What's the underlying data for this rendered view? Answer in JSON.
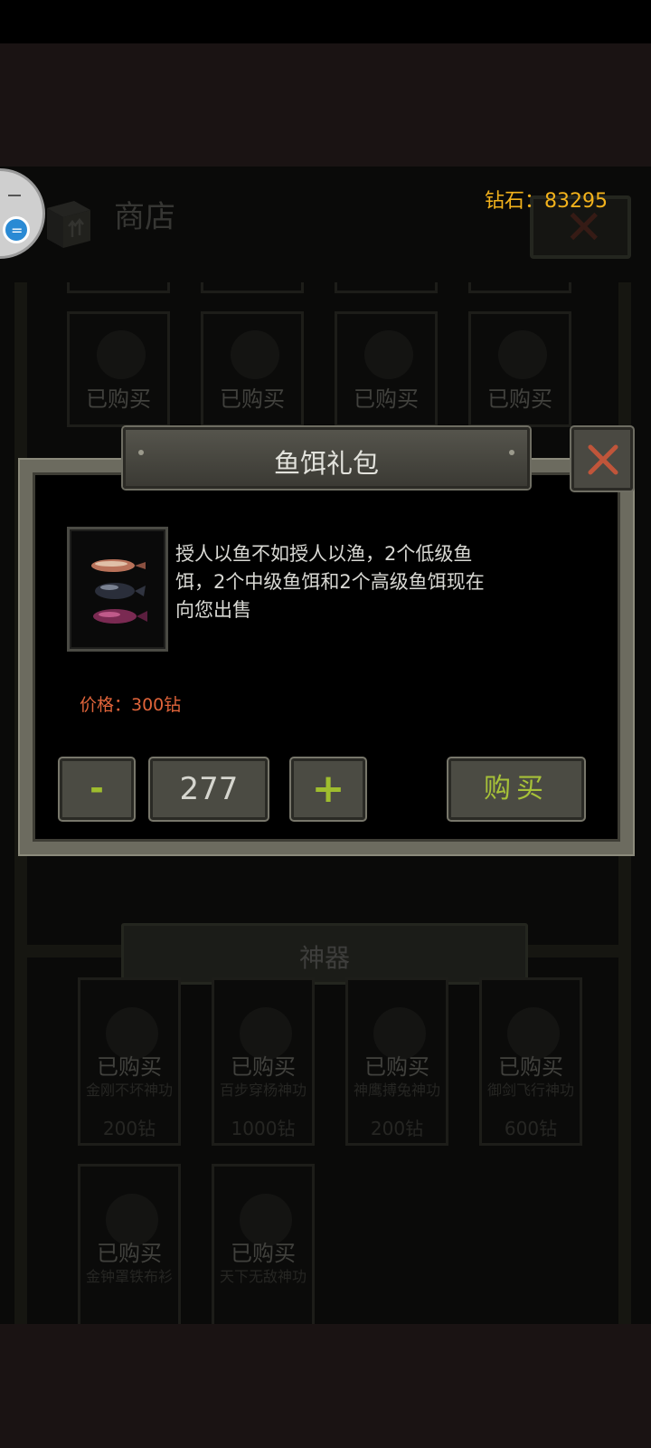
{
  "header": {
    "diamond_text": "钻石：83295"
  },
  "shop": {
    "title": "商店",
    "close_glyph": "✕",
    "row1_cards": [
      {
        "status": "已购买"
      },
      {
        "status": "已购买"
      },
      {
        "status": "已购买"
      },
      {
        "status": "已购买"
      }
    ],
    "section2": {
      "title": "神器",
      "cards": [
        {
          "status": "已购买",
          "name": "金刚不坏神功",
          "price": "200钻"
        },
        {
          "status": "已购买",
          "name": "百步穿杨神功",
          "price": "1000钻"
        },
        {
          "status": "已购买",
          "name": "神鹰搏兔神功",
          "price": "200钻"
        },
        {
          "status": "已购买",
          "name": "御剑飞行神功",
          "price": "600钻"
        },
        {
          "status": "已购买",
          "name": "金钟罩铁布衫"
        },
        {
          "status": "已购买",
          "name": "天下无敌神功"
        }
      ]
    }
  },
  "modal": {
    "title": "鱼饵礼包",
    "description": "授人以鱼不如授人以渔，2个低级鱼饵，2个中级鱼饵和2个高级鱼饵现在向您出售",
    "price": "价格：300钻",
    "minus_label": "-",
    "quantity": "277",
    "plus_label": "+",
    "buy_label": "购买"
  },
  "float_bubble": {
    "icon_label": "="
  },
  "colors": {
    "accent_green": "#a7c238",
    "diamond_gold": "#f2b21c",
    "price_orange": "#e0643a",
    "close_red": "#c0553a"
  },
  "icons": [
    "shop-box-icon",
    "close-icon",
    "fishing-lure-icon",
    "assistant-bubble-icon"
  ]
}
